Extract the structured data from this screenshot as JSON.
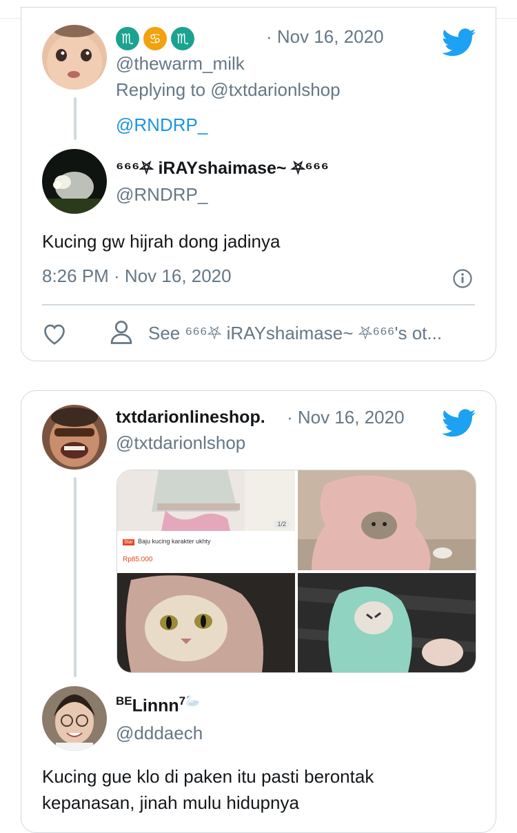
{
  "tweet1": {
    "zodiac": [
      "♏",
      "♋",
      "♏"
    ],
    "time_separator": "· Nov 16, 2020",
    "handle": "@thewarm_milk",
    "replying_to_prefix": "Replying to @txtdarionlshop",
    "mention": "@RNDRP_"
  },
  "quoted": {
    "display_name": "⁶⁶⁶⛧ iRAYshaimase~ ⛧⁶⁶⁶",
    "handle": "@RNDRP_",
    "text": "Kucing gw hijrah dong jadinya",
    "timestamp": "8:26 PM · Nov 16, 2020",
    "see_more": "See ⁶⁶⁶⛧ iRAYshaimase~ ⛧⁶⁶⁶'s ot..."
  },
  "tweet2": {
    "display_name": "txtdarionlineshop.",
    "time_separator": "· Nov 16, 2020",
    "handle": "@txtdarionlshop",
    "product": {
      "badge": "Star",
      "title": "Baju kucing karakter ukhty",
      "price": "Rp85.000",
      "pager": "1/2"
    }
  },
  "reply": {
    "display_name_prefix": "BE",
    "display_name": "Linnn",
    "display_name_suffix": "7🦢",
    "handle": "@dddaech",
    "text": "Kucing gue klo di paken itu pasti berontak kepanasan, jinah mulu hidupnya"
  },
  "colors": {
    "twitter_blue": "#1da1f2",
    "link_blue": "#1b95e0",
    "muted": "#657786",
    "border": "#cfd9de"
  },
  "icons": {
    "logo": "twitter-bird-icon",
    "like": "heart-icon",
    "profile": "person-icon",
    "info": "info-icon"
  }
}
